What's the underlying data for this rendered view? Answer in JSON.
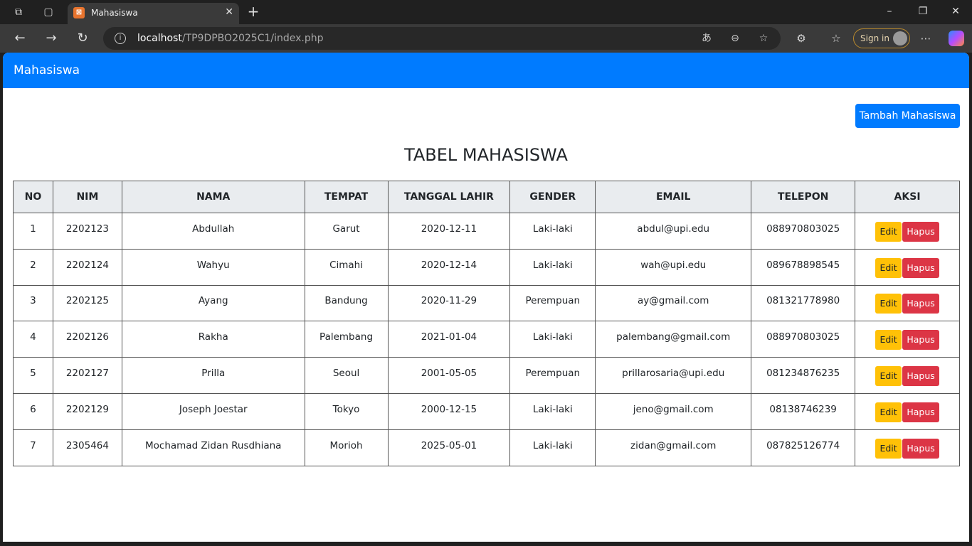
{
  "browser": {
    "tab_title": "Mahasiswa",
    "tab_favicon": "xampp-icon",
    "url_host": "localhost",
    "url_path": "/TP9DPBO2025C1/index.php",
    "signin_label": "Sign in"
  },
  "navbar": {
    "brand": "Mahasiswa",
    "color": "#007bff"
  },
  "add_button": {
    "label": "Tambah Mahasiswa"
  },
  "page_title": "TABEL MAHASISWA",
  "table": {
    "columns": [
      "NO",
      "NIM",
      "NAMA",
      "TEMPAT",
      "TANGGAL LAHIR",
      "GENDER",
      "EMAIL",
      "TELEPON",
      "AKSI"
    ],
    "rows": [
      [
        "1",
        "2202123",
        "Abdullah",
        "Garut",
        "2020-12-11",
        "Laki-laki",
        "abdul@upi.edu",
        "088970803025"
      ],
      [
        "2",
        "2202124",
        "Wahyu",
        "Cimahi",
        "2020-12-14",
        "Laki-laki",
        "wah@upi.edu",
        "089678898545"
      ],
      [
        "3",
        "2202125",
        "Ayang",
        "Bandung",
        "2020-11-29",
        "Perempuan",
        "ay@gmail.com",
        "081321778980"
      ],
      [
        "4",
        "2202126",
        "Rakha",
        "Palembang",
        "2021-01-04",
        "Laki-laki",
        "palembang@gmail.com",
        "088970803025"
      ],
      [
        "5",
        "2202127",
        "Prilla",
        "Seoul",
        "2001-05-05",
        "Perempuan",
        "prillarosaria@upi.edu",
        "081234876235"
      ],
      [
        "6",
        "2202129",
        "Joseph Joestar",
        "Tokyo",
        "2000-12-15",
        "Laki-laki",
        "jeno@gmail.com",
        "08138746239"
      ],
      [
        "7",
        "2305464",
        "Mochamad Zidan Rusdhiana",
        "Morioh",
        "2025-05-01",
        "Laki-laki",
        "zidan@gmail.com",
        "087825126774"
      ]
    ],
    "edit_label": "Edit",
    "delete_label": "Hapus",
    "edit_color": "#ffc107",
    "delete_color": "#dc3545"
  }
}
